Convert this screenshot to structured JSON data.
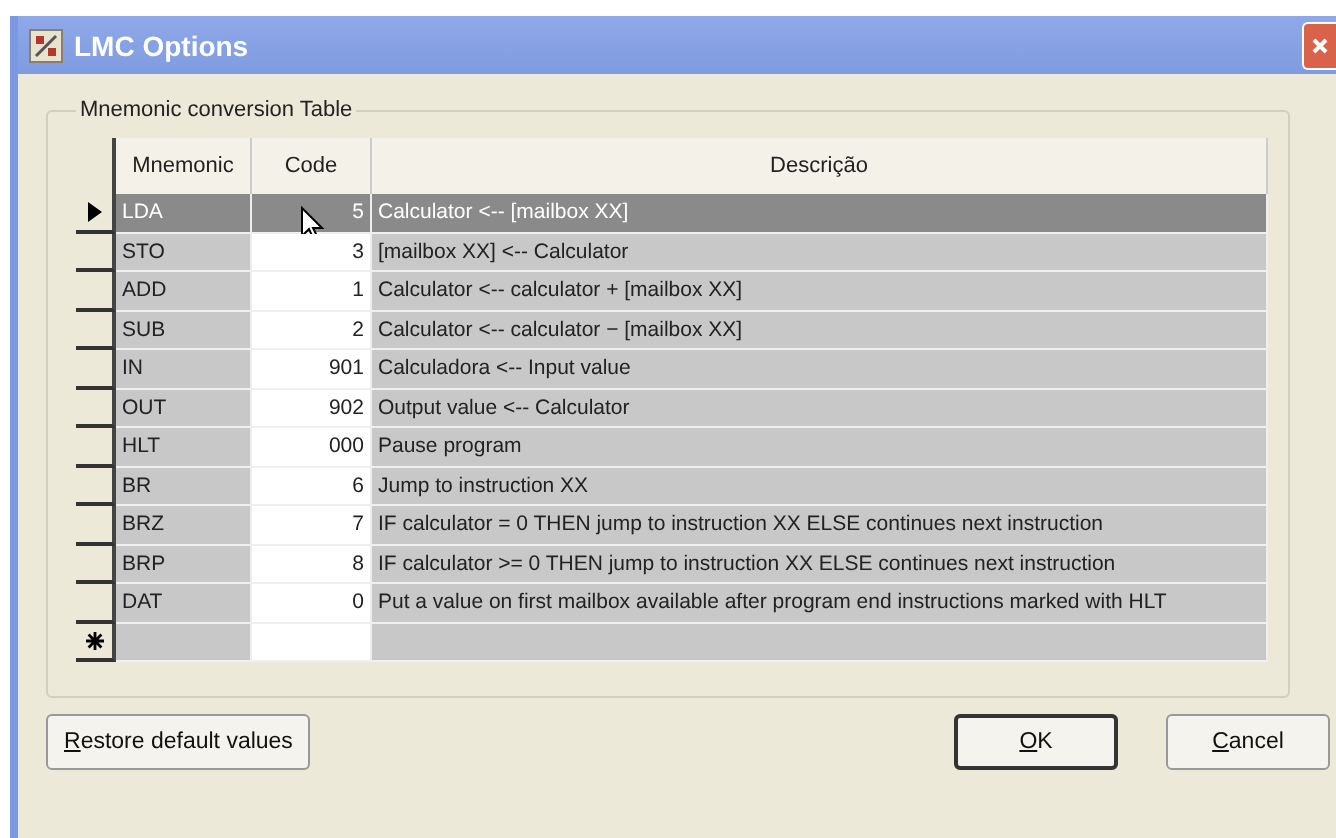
{
  "window": {
    "title": "LMC Options"
  },
  "group": {
    "title": "Mnemonic conversion Table"
  },
  "table": {
    "columns": [
      "Mnemonic",
      "Code",
      "Descrição"
    ],
    "rows": [
      {
        "mnemonic": "LDA",
        "code": "5",
        "description": "Calculator <-- [mailbox XX]",
        "selected": true
      },
      {
        "mnemonic": "STO",
        "code": "3",
        "description": "[mailbox XX] <-- Calculator",
        "selected": false
      },
      {
        "mnemonic": "ADD",
        "code": "1",
        "description": "Calculator <-- calculator + [mailbox XX]",
        "selected": false
      },
      {
        "mnemonic": "SUB",
        "code": "2",
        "description": "Calculator <-- calculator − [mailbox XX]",
        "selected": false
      },
      {
        "mnemonic": "IN",
        "code": "901",
        "description": "Calculadora <-- Input value",
        "selected": false
      },
      {
        "mnemonic": "OUT",
        "code": "902",
        "description": "Output value <-- Calculator",
        "selected": false
      },
      {
        "mnemonic": "HLT",
        "code": "000",
        "description": "Pause program",
        "selected": false
      },
      {
        "mnemonic": "BR",
        "code": "6",
        "description": "Jump to instruction XX",
        "selected": false
      },
      {
        "mnemonic": "BRZ",
        "code": "7",
        "description": "IF calculator = 0 THEN jump to instruction XX ELSE continues next instruction",
        "selected": false
      },
      {
        "mnemonic": "BRP",
        "code": "8",
        "description": "IF calculator >= 0 THEN jump to instruction XX ELSE continues next instruction",
        "selected": false
      },
      {
        "mnemonic": "DAT",
        "code": "0",
        "description": "Put a value on first mailbox available after program end instructions marked with HLT",
        "selected": false
      }
    ]
  },
  "buttons": [
    {
      "label": "Restore default values",
      "kind": "left"
    },
    {
      "label": "OK",
      "kind": "default"
    },
    {
      "label": "Cancel",
      "kind": "normal"
    }
  ]
}
